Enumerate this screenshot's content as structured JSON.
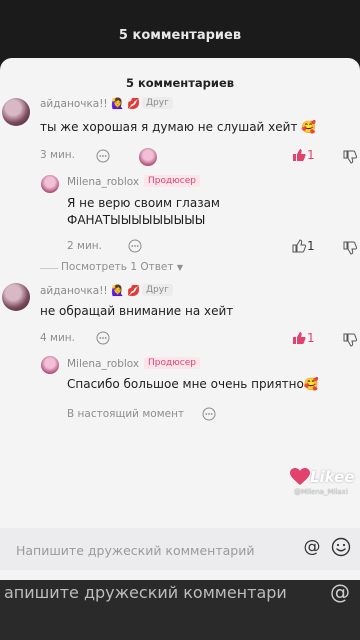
{
  "background": {
    "header_title": "5 комментариев",
    "footer_text": "апишите дружеский комментари",
    "footer_icon": "@"
  },
  "sheet": {
    "title": "5 комментариев"
  },
  "comments": [
    {
      "nick": "айданочка!!",
      "badges": "🙋‍♀️ 💋",
      "tag": "Друг",
      "text": "ты же хорошая я думаю не слушай хейт 🥰",
      "time": "3 мин.",
      "likes": "1",
      "liked": true
    },
    {
      "nick": "Milena_roblox",
      "tag": "Продюсер",
      "text": "Я не верю своим глазам ФАНАТЫЫЫЫЫЫЫЫЫ",
      "time": "2 мин.",
      "likes": "1",
      "liked": false
    },
    {
      "more_replies": "Посмотреть 1 Ответ"
    },
    {
      "nick": "айданочка!!",
      "badges": "🙋‍♀️ 💋",
      "tag": "Друг",
      "text": "не обращай внимание на хейт",
      "time": "4 мин.",
      "likes": "1",
      "liked": true
    },
    {
      "nick": "Milena_roblox",
      "tag": "Продюсер",
      "text": "Спасибо большое мне очень приятно🥰",
      "time": "В настоящий момент"
    }
  ],
  "emoji_bar": [
    "🥰",
    "😭",
    "❤️",
    "🥳",
    "😂",
    "😊",
    "🙏",
    "🥺",
    "😏",
    "😭"
  ],
  "input": {
    "placeholder": "Напишите дружеский комментарий",
    "at_icon": "@"
  },
  "watermark": {
    "brand": "Likee",
    "user": "@Milena_Milaxi"
  },
  "colors": {
    "accent": "#e2436e",
    "sheet_bg": "#f4f4f5"
  }
}
